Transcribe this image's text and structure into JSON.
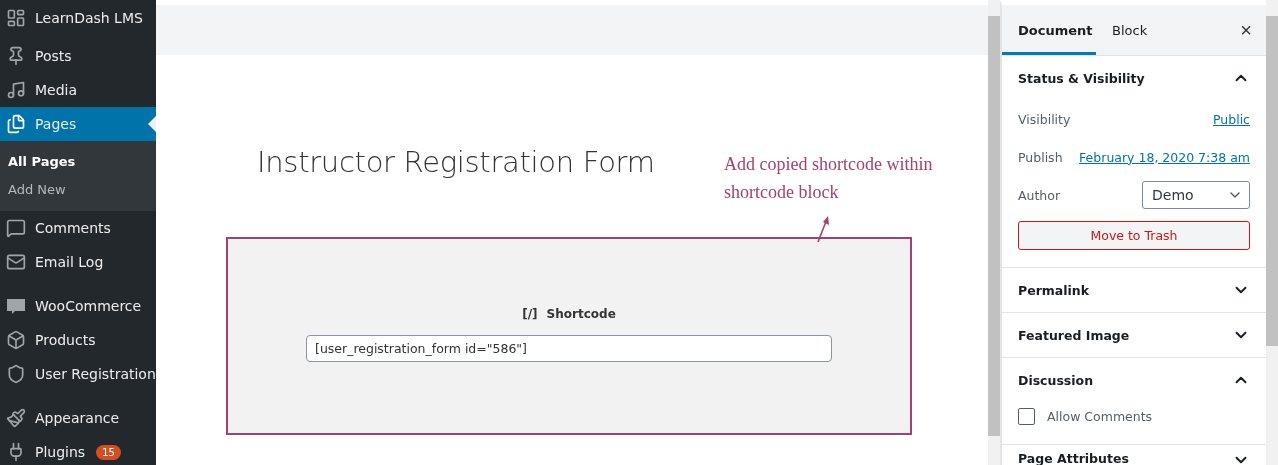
{
  "admin_menu": {
    "groups": [
      {
        "items": [
          {
            "label": "LearnDash LMS",
            "selected": false
          }
        ]
      },
      {
        "items": [
          {
            "label": "Posts",
            "selected": false
          },
          {
            "label": "Media",
            "selected": false
          },
          {
            "label": "Pages",
            "selected": true,
            "children": [
              {
                "label": "All Pages",
                "selected": true
              },
              {
                "label": "Add New",
                "selected": false
              }
            ]
          },
          {
            "label": "Comments",
            "selected": false
          },
          {
            "label": "Email Log",
            "selected": false
          }
        ]
      },
      {
        "items": [
          {
            "label": "WooCommerce",
            "selected": false
          },
          {
            "label": "Products",
            "selected": false
          },
          {
            "label": "User Registration",
            "selected": false
          }
        ]
      },
      {
        "items": [
          {
            "label": "Appearance",
            "selected": false
          },
          {
            "label": "Plugins",
            "selected": false,
            "badge": "15"
          }
        ]
      }
    ]
  },
  "editor": {
    "title": "Instructor Registration Form",
    "shortcode_block": {
      "icon": "[/]",
      "label": "Shortcode",
      "value": "[user_registration_form id=\"586\"]"
    },
    "annotation": "Add copied shortcode within shortcode block"
  },
  "settings_sidebar": {
    "tabs": [
      {
        "label": "Document",
        "selected": true
      },
      {
        "label": "Block",
        "selected": false
      }
    ],
    "close": "×",
    "sections": [
      {
        "kind": "status",
        "title": "Status & Visibility",
        "expanded": true,
        "rows": [
          {
            "label": "Visibility",
            "value": "Public"
          },
          {
            "label": "Publish",
            "value": "February 18, 2020 7:38 am"
          }
        ],
        "author": {
          "label": "Author",
          "value": "Demo"
        },
        "trash_button": "Move to Trash"
      },
      {
        "kind": "plain",
        "title": "Permalink",
        "expanded": false
      },
      {
        "kind": "plain",
        "title": "Featured Image",
        "expanded": false
      },
      {
        "kind": "discussion",
        "title": "Discussion",
        "expanded": true,
        "checkbox": {
          "label": "Allow Comments",
          "checked": false
        }
      },
      {
        "kind": "plain",
        "title": "Page Attributes",
        "expanded": false
      }
    ]
  }
}
